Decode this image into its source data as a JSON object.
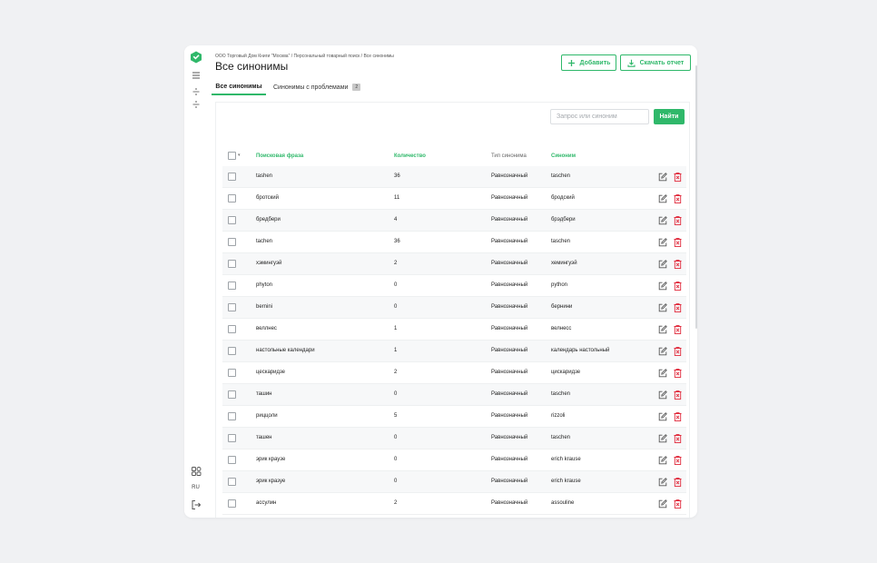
{
  "sidebar": {
    "language": "RU"
  },
  "header": {
    "breadcrumb": "ООО Торговый Дом Книги \"Москва\" / Персональный товарный поиск / Все синонимы",
    "title": "Все синонимы",
    "add_label": "Добавить",
    "report_label": "Скачать отчет"
  },
  "tabs": [
    {
      "label": "Все синонимы"
    },
    {
      "label": "Синонимы с проблемами",
      "badge": "2"
    }
  ],
  "search": {
    "placeholder": "Запрос или синоним",
    "button_label": "Найти"
  },
  "table": {
    "columns": [
      "Поисковая фраза",
      "Количество",
      "Тип синонима",
      "Синоним"
    ],
    "rows": [
      {
        "phrase": "tashen",
        "qty": "36",
        "type": "Равнозначный",
        "synonym": "taschen"
      },
      {
        "phrase": "бротский",
        "qty": "11",
        "type": "Равнозначный",
        "synonym": "бродский"
      },
      {
        "phrase": "бредбери",
        "qty": "4",
        "type": "Равнозначный",
        "synonym": "брэдбери"
      },
      {
        "phrase": "tachen",
        "qty": "36",
        "type": "Равнозначный",
        "synonym": "taschen"
      },
      {
        "phrase": "хэмингуэй",
        "qty": "2",
        "type": "Равнозначный",
        "synonym": "хемингуэй"
      },
      {
        "phrase": "phyton",
        "qty": "0",
        "type": "Равнозначный",
        "synonym": "python"
      },
      {
        "phrase": "bernini",
        "qty": "0",
        "type": "Равнозначный",
        "synonym": "бернини"
      },
      {
        "phrase": "веллнес",
        "qty": "1",
        "type": "Равнозначный",
        "synonym": "велнесс"
      },
      {
        "phrase": "настольные календари",
        "qty": "1",
        "type": "Равнозначный",
        "synonym": "календарь настольный"
      },
      {
        "phrase": "цескаридзе",
        "qty": "2",
        "type": "Равнозначный",
        "synonym": "цискаридзе"
      },
      {
        "phrase": "ташин",
        "qty": "0",
        "type": "Равнозначный",
        "synonym": "taschen"
      },
      {
        "phrase": "риццоли",
        "qty": "5",
        "type": "Равнозначный",
        "synonym": "rizzoli"
      },
      {
        "phrase": "ташен",
        "qty": "0",
        "type": "Равнозначный",
        "synonym": "taschen"
      },
      {
        "phrase": "эрик краузе",
        "qty": "0",
        "type": "Равнозначный",
        "synonym": "erich krause"
      },
      {
        "phrase": "эрик кразуе",
        "qty": "0",
        "type": "Равнозначный",
        "synonym": "erich krause"
      },
      {
        "phrase": "ассулин",
        "qty": "2",
        "type": "Равнозначный",
        "synonym": "assouline"
      }
    ]
  },
  "colors": {
    "accent": "#2fb86a",
    "delete": "#e0283a"
  }
}
